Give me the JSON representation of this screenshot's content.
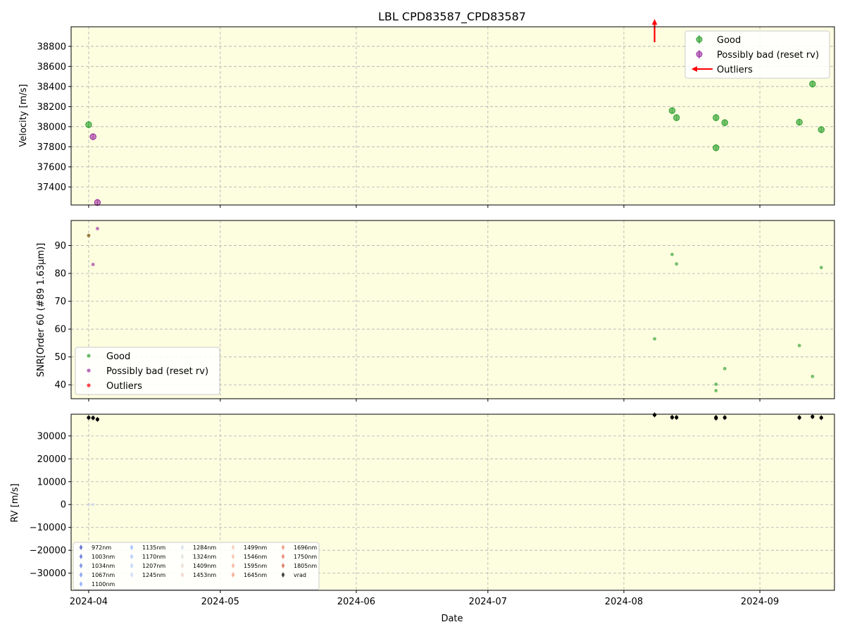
{
  "colors": {
    "panel_bg": "#fdfde0",
    "good": "#2ca02c",
    "bad": "#9b30a0",
    "outlier": "#ff0000",
    "vrad": "#000000",
    "grid": "#b0b0b0"
  },
  "chart_data": [
    {
      "type": "scatter",
      "panel": "velocity",
      "title": "LBL CPD83587_CPD83587",
      "ylabel": "Velocity [m/s]",
      "xlim": [
        "2024-03-28",
        "2024-09-18"
      ],
      "ylim": [
        37220,
        38995
      ],
      "yticks": [
        37400,
        37600,
        37800,
        38000,
        38200,
        38400,
        38600,
        38800
      ],
      "grid": true,
      "legend_position": "upper-right",
      "legend": [
        "Good",
        "Possibly bad (reset rv)",
        "Outliers"
      ],
      "series": [
        {
          "name": "Good",
          "points": [
            {
              "x": "2024-04-01",
              "y": 38020
            },
            {
              "x": "2024-08-12",
              "y": 38160
            },
            {
              "x": "2024-08-13",
              "y": 38090
            },
            {
              "x": "2024-08-22",
              "y": 38090
            },
            {
              "x": "2024-08-22",
              "y": 37790
            },
            {
              "x": "2024-08-24",
              "y": 38040
            },
            {
              "x": "2024-09-10",
              "y": 38045
            },
            {
              "x": "2024-09-13",
              "y": 38425
            },
            {
              "x": "2024-09-15",
              "y": 37970
            }
          ]
        },
        {
          "name": "Possibly bad (reset rv)",
          "points": [
            {
              "x": "2024-04-02",
              "y": 37900
            },
            {
              "x": "2024-04-03",
              "y": 37245
            }
          ]
        },
        {
          "name": "Outliers",
          "arrows": [
            {
              "x": "2024-08-08",
              "direction": "up"
            }
          ]
        }
      ]
    },
    {
      "type": "scatter",
      "panel": "snr",
      "ylabel": "SNR[Order 60 (#89 1.63μm)]",
      "xlim": [
        "2024-03-28",
        "2024-09-18"
      ],
      "ylim": [
        35,
        99
      ],
      "yticks": [
        40,
        50,
        60,
        70,
        80,
        90
      ],
      "grid": true,
      "legend_position": "lower-left",
      "legend": [
        "Good",
        "Possibly bad (reset rv)",
        "Outliers"
      ],
      "series": [
        {
          "name": "Good",
          "points": [
            {
              "x": "2024-08-08",
              "y": 56.5
            },
            {
              "x": "2024-08-12",
              "y": 86.8
            },
            {
              "x": "2024-08-13",
              "y": 83.4
            },
            {
              "x": "2024-08-22",
              "y": 40.2
            },
            {
              "x": "2024-08-22",
              "y": 37.9
            },
            {
              "x": "2024-08-24",
              "y": 45.8
            },
            {
              "x": "2024-09-10",
              "y": 54.1
            },
            {
              "x": "2024-09-13",
              "y": 43.0
            },
            {
              "x": "2024-09-15",
              "y": 82.1
            }
          ]
        },
        {
          "name": "Possibly bad (reset rv)",
          "points": [
            {
              "x": "2024-04-02",
              "y": 83.2
            },
            {
              "x": "2024-04-03",
              "y": 96.1
            }
          ]
        },
        {
          "name": "Outliers",
          "points": [
            {
              "x": "2024-04-01",
              "y": 93.6
            }
          ]
        }
      ]
    },
    {
      "type": "scatter",
      "panel": "rv",
      "ylabel": "RV [m/s]",
      "xlabel": "Date",
      "xlim": [
        "2024-03-28",
        "2024-09-18"
      ],
      "ylim": [
        -37500,
        39500
      ],
      "yticks": [
        -30000,
        -20000,
        -10000,
        0,
        10000,
        20000,
        30000
      ],
      "xticks": [
        "2024-04",
        "2024-05",
        "2024-06",
        "2024-07",
        "2024-08",
        "2024-09"
      ],
      "xtick_dates": [
        "2024-04-01",
        "2024-05-01",
        "2024-06-01",
        "2024-07-01",
        "2024-08-01",
        "2024-09-01"
      ],
      "grid": true,
      "legend_position": "lower-left",
      "legend_columns": [
        [
          {
            "label": "972nm",
            "color": "#3b4cc0"
          },
          {
            "label": "1003nm",
            "color": "#4a63d3"
          },
          {
            "label": "1034nm",
            "color": "#5a78e0"
          },
          {
            "label": "1067nm",
            "color": "#6c8ff0"
          },
          {
            "label": "1100nm",
            "color": "#7ea1f7"
          }
        ],
        [
          {
            "label": "1135nm",
            "color": "#90b2fe"
          },
          {
            "label": "1170nm",
            "color": "#a3c2fe"
          },
          {
            "label": "1207nm",
            "color": "#b4cdfa"
          },
          {
            "label": "1245nm",
            "color": "#c4d5f3"
          }
        ],
        [
          {
            "label": "1284nm",
            "color": "#d2dbe8"
          },
          {
            "label": "1324nm",
            "color": "#dddcdc"
          },
          {
            "label": "1409nm",
            "color": "#e8d6cc"
          },
          {
            "label": "1453nm",
            "color": "#efcebd"
          }
        ],
        [
          {
            "label": "1499nm",
            "color": "#f4c4ab"
          },
          {
            "label": "1546nm",
            "color": "#f6b89c"
          },
          {
            "label": "1595nm",
            "color": "#f5a889"
          },
          {
            "label": "1645nm",
            "color": "#f29778"
          }
        ],
        [
          {
            "label": "1696nm",
            "color": "#ec8466"
          },
          {
            "label": "1750nm",
            "color": "#e26f54"
          },
          {
            "label": "1805nm",
            "color": "#d65a44"
          },
          {
            "label": "vrad",
            "color": "#000000"
          }
        ]
      ],
      "series": [
        {
          "name": "vrad",
          "points": [
            {
              "x": "2024-04-01",
              "y": 38020
            },
            {
              "x": "2024-04-02",
              "y": 37900
            },
            {
              "x": "2024-04-03",
              "y": 37245
            },
            {
              "x": "2024-08-08",
              "y": 39200
            },
            {
              "x": "2024-08-12",
              "y": 38160
            },
            {
              "x": "2024-08-13",
              "y": 38090
            },
            {
              "x": "2024-08-22",
              "y": 38090
            },
            {
              "x": "2024-08-22",
              "y": 37790
            },
            {
              "x": "2024-08-24",
              "y": 38040
            },
            {
              "x": "2024-09-10",
              "y": 38045
            },
            {
              "x": "2024-09-13",
              "y": 38425
            },
            {
              "x": "2024-09-15",
              "y": 37970
            }
          ]
        },
        {
          "name": "per-order (faint)",
          "points": [
            {
              "x": "2024-04-01",
              "y": 0
            },
            {
              "x": "2024-04-02",
              "y": 0
            }
          ]
        }
      ]
    }
  ]
}
